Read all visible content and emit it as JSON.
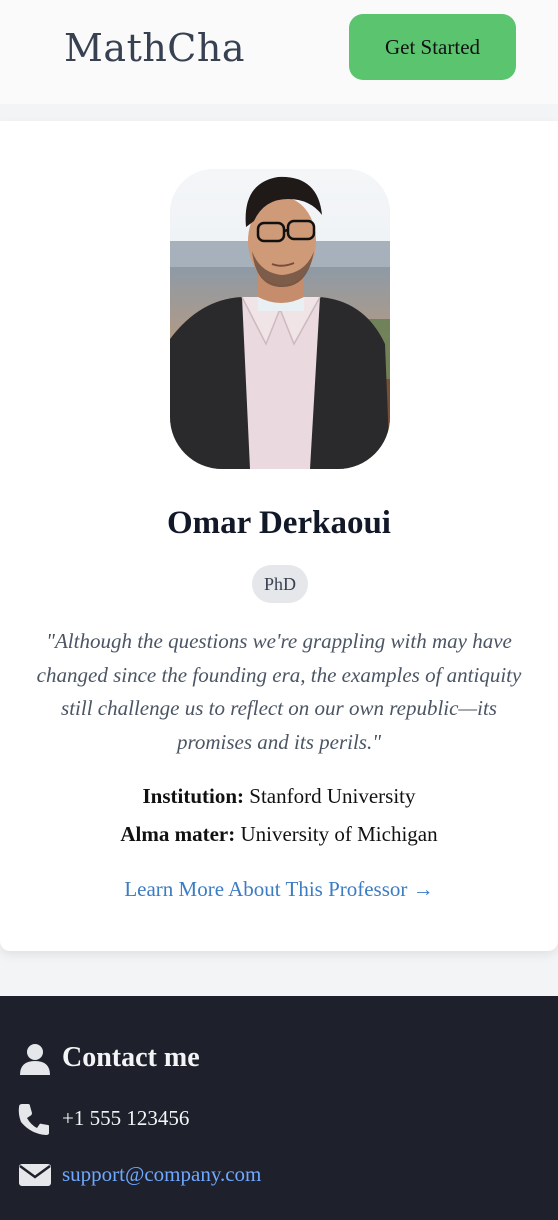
{
  "header": {
    "logo": "MathCha",
    "cta_label": "Get Started"
  },
  "professor": {
    "name": "Omar Derkaoui",
    "degree": "PhD",
    "quote": "\"Although the questions we're grappling with may have changed since the founding era, the examples of antiquity still challenge us to reflect on our own republic—its promises and its perils.\"",
    "institution_label": "Institution:",
    "institution": "Stanford University",
    "alma_mater_label": "Alma mater:",
    "alma_mater": "University of Michigan",
    "learn_more": "Learn More About This Professor →"
  },
  "footer": {
    "title": "Contact me",
    "phone": "+1 555 123456",
    "email": "support@company.com",
    "icons": [
      "user-icon",
      "phone-icon",
      "envelope-icon"
    ]
  },
  "colors": {
    "cta": "#5ac46f",
    "link": "#3b7cc4",
    "footer_bg": "#1e212b",
    "footer_link": "#6ea8ff"
  }
}
